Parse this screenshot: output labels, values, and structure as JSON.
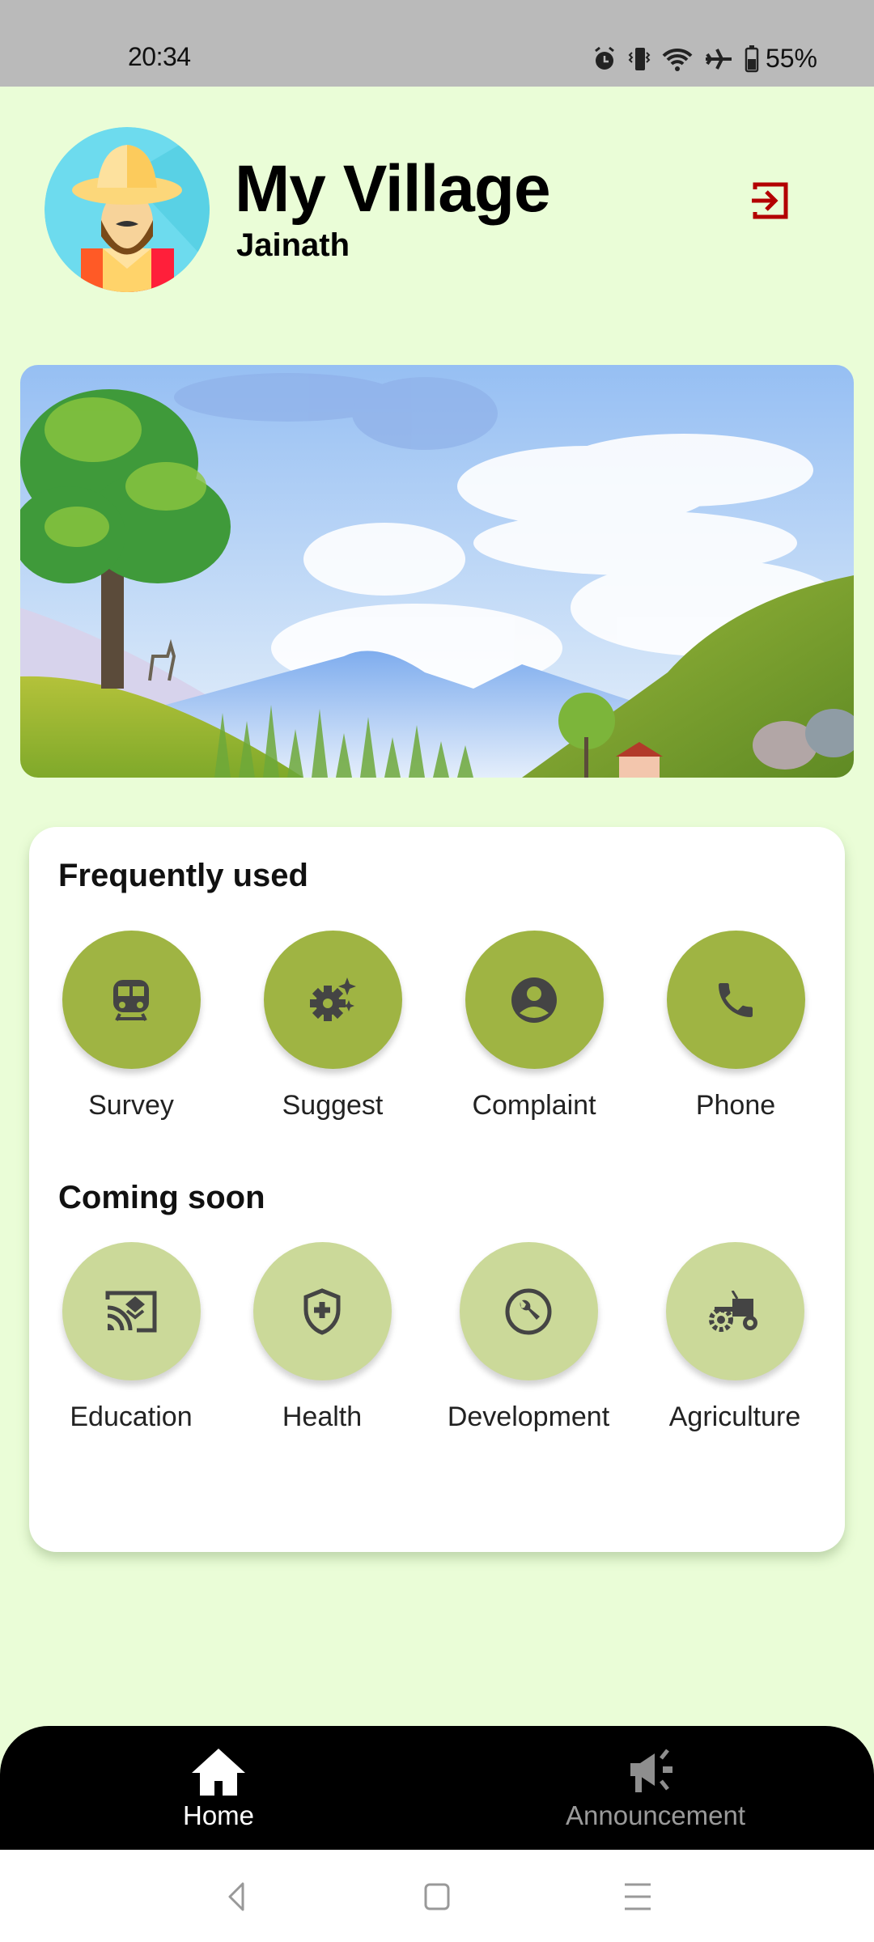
{
  "status_bar": {
    "time": "20:34",
    "icons": [
      "alarm-icon",
      "vibrate-icon",
      "wifi-icon",
      "airplane-mode-icon",
      "battery-icon"
    ],
    "battery_percent": "55%"
  },
  "header": {
    "title": "My Village",
    "subtitle": "Jainath",
    "avatar": "farmer-avatar",
    "logout_icon": "logout-icon"
  },
  "banner": {
    "image": "village-landscape-illustration"
  },
  "sections": {
    "frequently_used": {
      "title": "Frequently used",
      "items": [
        {
          "label": "Survey",
          "icon": "train-icon"
        },
        {
          "label": "Suggest",
          "icon": "settings-sparkle-icon"
        },
        {
          "label": "Complaint",
          "icon": "account-circle-icon"
        },
        {
          "label": "Phone",
          "icon": "phone-icon"
        }
      ]
    },
    "coming_soon": {
      "title": "Coming soon",
      "items": [
        {
          "label": "Education",
          "icon": "cast-for-education-icon"
        },
        {
          "label": "Health",
          "icon": "health-shield-icon"
        },
        {
          "label": "Development",
          "icon": "build-circle-icon"
        },
        {
          "label": "Agriculture",
          "icon": "tractor-icon"
        }
      ]
    }
  },
  "bottom_nav": {
    "items": [
      {
        "label": "Home",
        "icon": "home-icon",
        "active": true
      },
      {
        "label": "Announcement",
        "icon": "campaign-icon",
        "active": false
      }
    ]
  },
  "system_nav": {
    "buttons": [
      "back",
      "home",
      "recents"
    ]
  },
  "colors": {
    "background": "#eafdd7",
    "active_tile": "#9fb443",
    "soon_tile": "#cbd999",
    "logout": "#b30000",
    "nav_bg": "#000000"
  }
}
